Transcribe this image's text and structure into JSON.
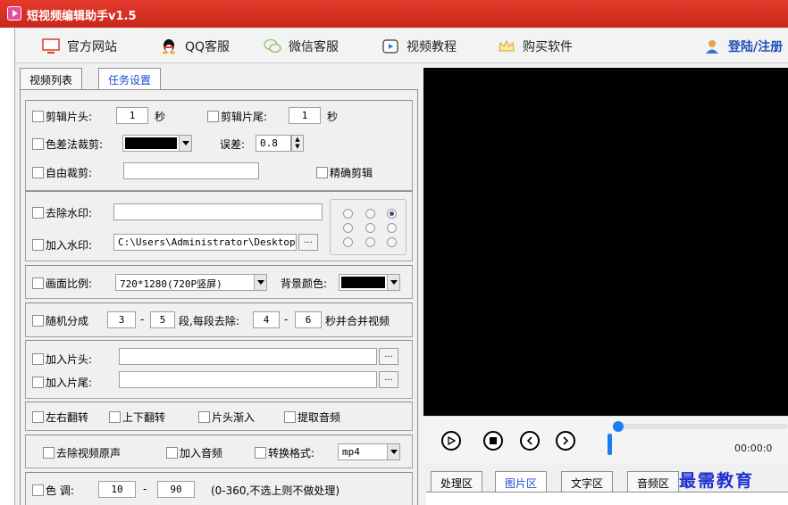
{
  "app": {
    "title": "短视频编辑助手v1.5"
  },
  "toolbar": {
    "items": [
      {
        "label": "官方网站",
        "icon": "monitor-icon"
      },
      {
        "label": "QQ客服",
        "icon": "qq-penguin-icon"
      },
      {
        "label": "微信客服",
        "icon": "wechat-icon"
      },
      {
        "label": "视频教程",
        "icon": "play-box-icon"
      },
      {
        "label": "购买软件",
        "icon": "crown-icon"
      }
    ],
    "login": "登陆/注册"
  },
  "left_tabs": [
    "视频列表",
    "任务设置"
  ],
  "settings": {
    "trim_head": "剪辑片头:",
    "trim_head_value": "1",
    "sec1": "秒",
    "trim_tail": "剪辑片尾:",
    "trim_tail_value": "1",
    "sec2": "秒",
    "color_crop": "色差法裁剪:",
    "tolerance": "误差:",
    "tolerance_value": "0.8",
    "free_crop": "自由裁剪:",
    "precise": "精确剪辑",
    "remove_wm": "去除水印:",
    "add_wm": "加入水印:",
    "wm_path": "C:\\Users\\Administrator\\Desktop\\",
    "browse": "...",
    "ratio": "画面比例:",
    "ratio_value": "720*1280(720P竖屏)",
    "bg_color": "背景颜色:",
    "random_split": "随机分成",
    "split_min": "3",
    "dash1": "-",
    "split_max": "5",
    "per_seg": "段,每段去除:",
    "rm_min": "4",
    "dash2": "-",
    "rm_max": "6",
    "merge": "秒并合并视频",
    "add_intro": "加入片头:",
    "add_outro": "加入片尾:",
    "flip_h": "左右翻转",
    "flip_v": "上下翻转",
    "fade_in": "片头渐入",
    "extract_audio": "提取音频",
    "remove_audio": "去除视频原声",
    "add_audio": "加入音频",
    "convert": "转换格式:",
    "format": "mp4",
    "hue": "色  调:",
    "hue_min": "10",
    "dash3": "-",
    "hue_max": "90",
    "hue_hint": "(0-360,不选上则不做处理)"
  },
  "player": {
    "time": "00:00:0"
  },
  "right_tabs": [
    "处理区",
    "图片区",
    "文字区",
    "音频区"
  ],
  "watermark_text": "最需教育",
  "colors": {
    "title_bar": "#d32f23",
    "accent_blue": "#1e7cf2",
    "preview_bg": "#000000"
  }
}
